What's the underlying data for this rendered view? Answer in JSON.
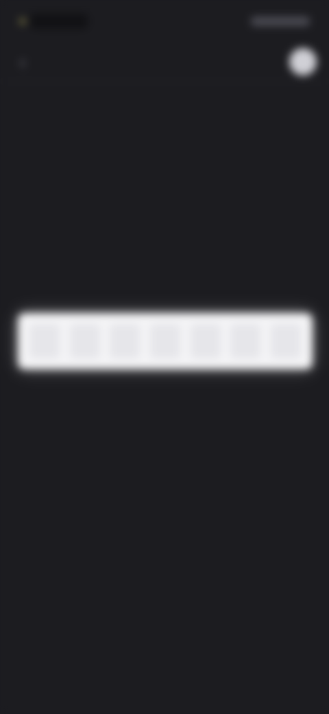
{
  "colors": {
    "background": "#1c1c20",
    "code_box": "#f4f4f6",
    "avatar": "#d0d0d6"
  },
  "icons": {
    "back": "chevron-left-icon",
    "avatar": "avatar"
  },
  "app_bar": {
    "back_glyph": "‹"
  },
  "code": {
    "cells": [
      "",
      "",
      "",
      "",
      "",
      "",
      ""
    ]
  }
}
